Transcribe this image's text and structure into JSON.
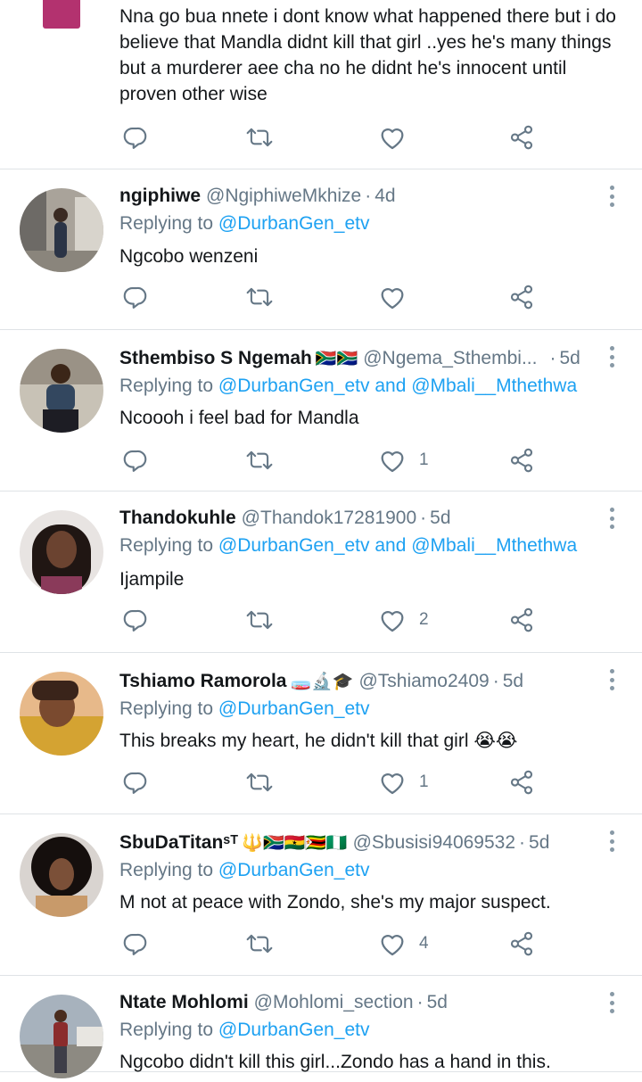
{
  "reply_prefix": "Replying to",
  "and_word": "and",
  "tweets": [
    {
      "body": "Nna go bua nnete i dont know what happened there but i do believe that Mandla didnt  kill that girl  ..yes he's  many things but a murderer  aee cha no he didnt he's  innocent until proven other wise",
      "likes": ""
    },
    {
      "name": "ngiphiwe",
      "emoji": "",
      "handle": "@NgiphiweMkhize",
      "time": "4d",
      "mentions": [
        "@DurbanGen_etv"
      ],
      "body": "Ngcobo wenzeni",
      "likes": ""
    },
    {
      "name": "Sthembiso S Ngemah",
      "emoji": "🇿🇦🇿🇦",
      "handle": "@Ngema_Sthembi...",
      "time": "5d",
      "mentions": [
        "@DurbanGen_etv",
        "@Mbali__Mthethwa"
      ],
      "body": "Ncoooh i feel bad for Mandla",
      "likes": "1"
    },
    {
      "name": "Thandokuhle",
      "emoji": "",
      "handle": "@Thandok17281900",
      "time": "5d",
      "mentions": [
        "@DurbanGen_etv",
        "@Mbali__Mthethwa"
      ],
      "body": "Ijampile",
      "likes": "2"
    },
    {
      "name": "Tshiamo Ramorola",
      "emoji": "🧫🔬🎓",
      "handle": "@Tshiamo2409",
      "time": "5d",
      "mentions": [
        "@DurbanGen_etv"
      ],
      "body": "This breaks my heart, he didn't kill that girl 😭😭",
      "likes": "1"
    },
    {
      "name": "SbuDaTitanˢᵀ",
      "emoji": "🔱🇿🇦🇬🇭🇿🇼🇳🇬",
      "handle": "@Sbusisi94069532",
      "time": "5d",
      "mentions": [
        "@DurbanGen_etv"
      ],
      "body": "M not at peace with Zondo, she's my major suspect.",
      "likes": "4"
    },
    {
      "name": "Ntate Mohlomi",
      "emoji": "",
      "handle": "@Mohlomi_section",
      "time": "5d",
      "mentions": [
        "@DurbanGen_etv"
      ],
      "body": "Ngcobo didn't kill this girl...Zondo has a hand in this.",
      "likes": ""
    }
  ],
  "colors": {
    "accent": "#1da1f2",
    "muted": "#657786",
    "text": "#14171a",
    "divider": "#dfe3e6",
    "icon": "#657786"
  },
  "icons": {
    "reply": "reply-icon",
    "retweet": "retweet-icon",
    "like": "heart-icon",
    "share": "share-icon",
    "more": "more-vertical-icon"
  }
}
